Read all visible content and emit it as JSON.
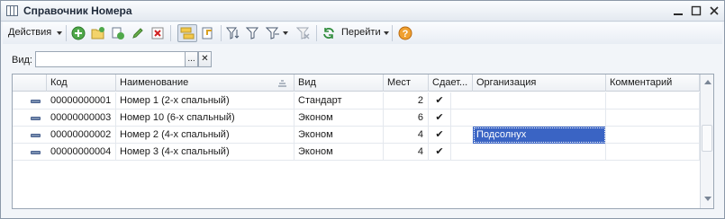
{
  "window": {
    "title": "Справочник Номера"
  },
  "toolbar": {
    "actions_label": "Действия",
    "goto_label": "Перейти"
  },
  "filter": {
    "label": "Вид:",
    "value": "",
    "select_btn": "...",
    "clear_btn": "✕"
  },
  "table": {
    "columns": [
      "Код",
      "Наименование",
      "Вид",
      "Мест",
      "Сдает...",
      "Организация",
      "Комментарий"
    ],
    "rows": [
      {
        "code": "00000000001",
        "name": "Номер 1 (2-х спальный)",
        "type": "Стандарт",
        "seats": "2",
        "rents": "✔",
        "org": "",
        "comment": ""
      },
      {
        "code": "00000000003",
        "name": "Номер 10 (6-х спальный)",
        "type": "Эконом",
        "seats": "6",
        "rents": "✔",
        "org": "",
        "comment": ""
      },
      {
        "code": "00000000002",
        "name": "Номер 2 (4-х спальный)",
        "type": "Эконом",
        "seats": "4",
        "rents": "✔",
        "org": "Подсолнух",
        "comment": ""
      },
      {
        "code": "00000000004",
        "name": "Номер 3 (4-х спальный)",
        "type": "Эконом",
        "seats": "4",
        "rents": "✔",
        "org": "",
        "comment": ""
      }
    ]
  },
  "colors": {
    "selection": "#3a64c4",
    "window_bg": "#f2f5f9"
  }
}
